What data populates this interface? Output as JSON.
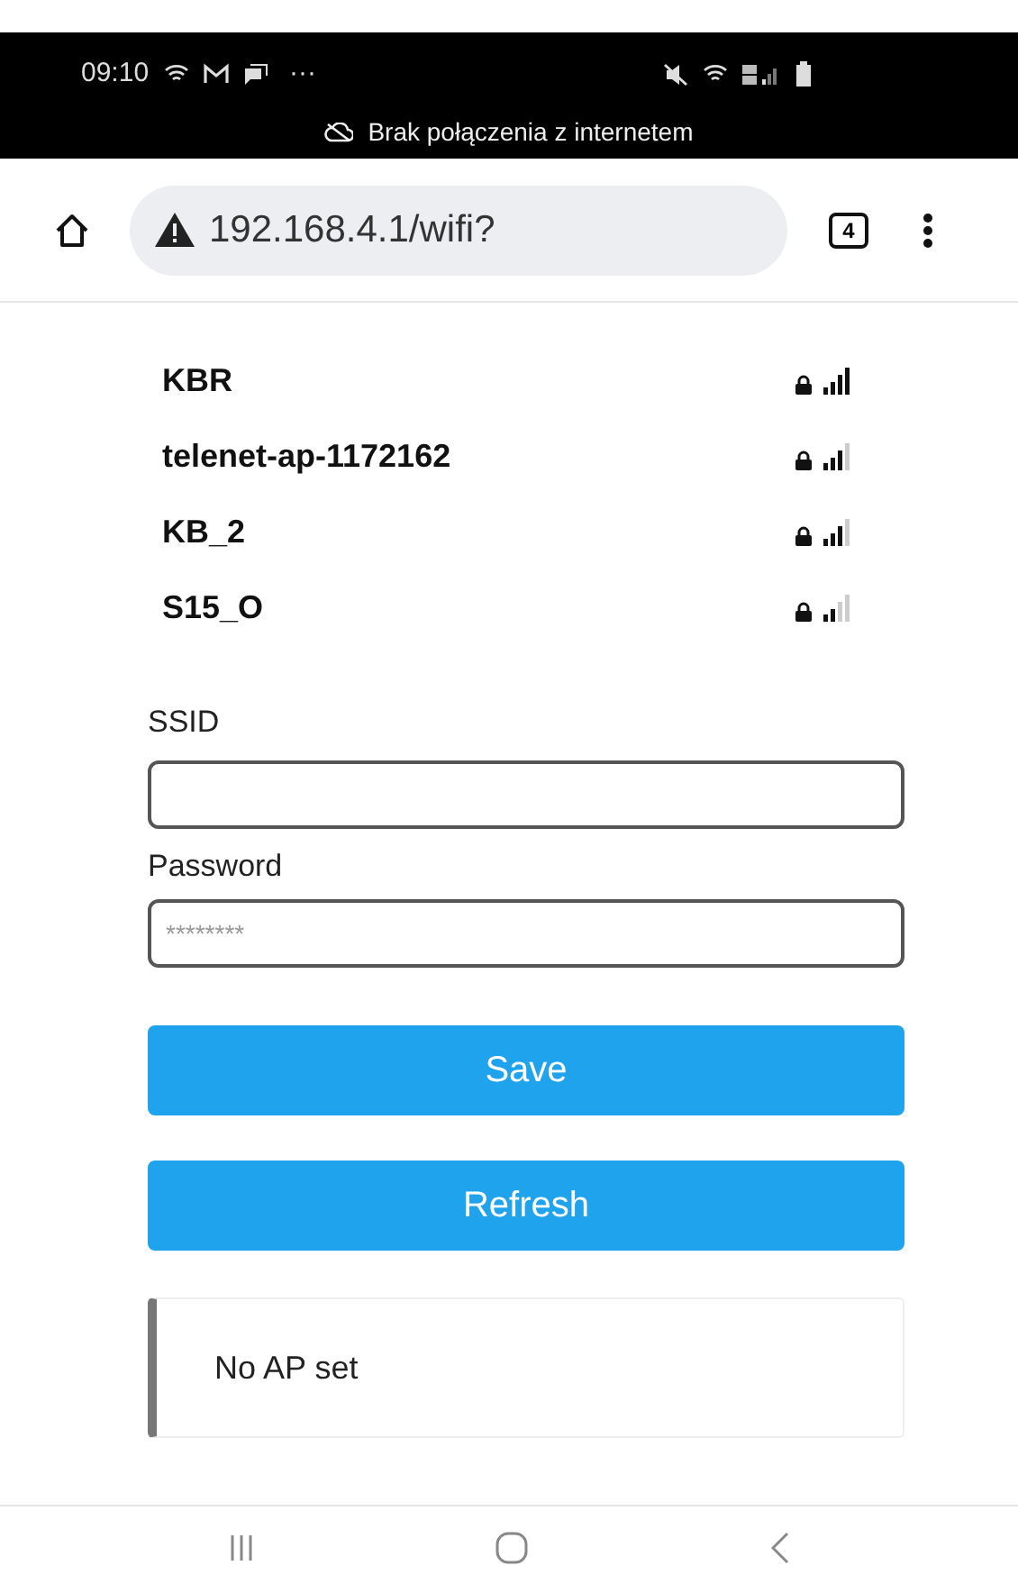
{
  "status_bar": {
    "time": "09:10",
    "dots": "···",
    "notice": "Brak połączenia z internetem"
  },
  "browser": {
    "url": "192.168.4.1/wifi?",
    "tab_count": "4"
  },
  "networks": [
    {
      "name": "KBR",
      "kind": "full"
    },
    {
      "name": "telenet-ap-1172162",
      "kind": "high"
    },
    {
      "name": "KB_2",
      "kind": "high"
    },
    {
      "name": "S15_O",
      "kind": "medium"
    }
  ],
  "form": {
    "ssid_label": "SSID",
    "password_label": "Password",
    "password_placeholder": "********"
  },
  "buttons": [
    "Save",
    "Refresh"
  ],
  "message": "No AP set"
}
